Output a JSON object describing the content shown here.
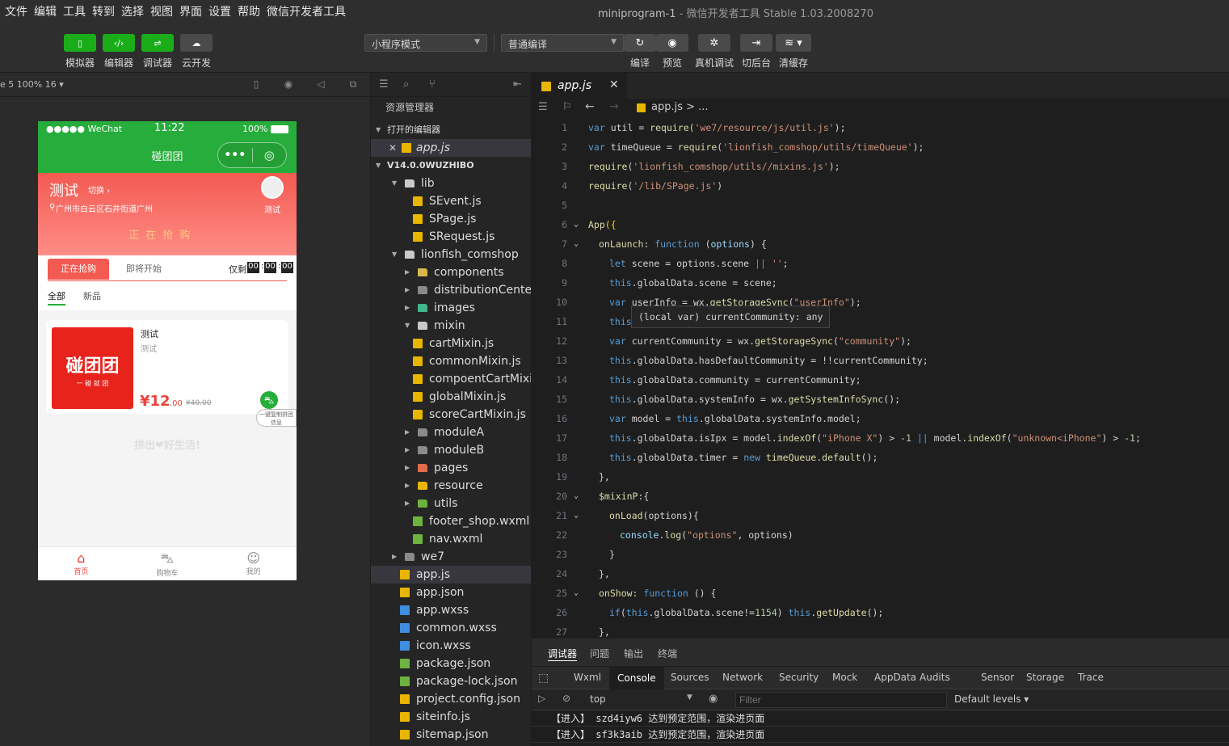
{
  "menu": {
    "items": [
      "文件",
      "编辑",
      "工具",
      "转到",
      "选择",
      "视图",
      "界面",
      "设置",
      "帮助",
      "微信开发者工具"
    ],
    "project": "miniprogram-1",
    "app_name": "微信开发者工具 Stable 1.03.2008270"
  },
  "toolbar": {
    "left": [
      {
        "label": "模拟器",
        "icon": "phone-icon"
      },
      {
        "label": "编辑器",
        "icon": "code-icon"
      },
      {
        "label": "调试器",
        "icon": "sliders-icon"
      },
      {
        "label": "云开发",
        "icon": "cloud-icon"
      }
    ],
    "mode_select": "小程序模式",
    "compile_select": "普通编译",
    "right": [
      {
        "label": "编译",
        "icon": "refresh-icon"
      },
      {
        "label": "预览",
        "icon": "eye-icon"
      },
      {
        "label": "真机调试",
        "icon": "bug-icon"
      },
      {
        "label": "切后台",
        "icon": "switch-icon"
      },
      {
        "label": "清缓存",
        "icon": "layers-icon"
      }
    ]
  },
  "simulator": {
    "device": "e 5 100% 16 ▾",
    "status": {
      "carrier": "●●●●● WeChat",
      "time": "11:22",
      "battery": "100%"
    },
    "nav_title": "碰团团",
    "banner": {
      "title": "测试",
      "switch": "切换 ›",
      "address": "广州市白云区石井街道广州",
      "avatar_label": "测试",
      "watermark": "正 在 抢 购"
    },
    "tabs": {
      "active": "正在抢购",
      "other": "即将开始",
      "countdown_label": "仅剩",
      "h": "00",
      "m": "00",
      "s": "00"
    },
    "subtabs": [
      "全部",
      "新品"
    ],
    "product": {
      "image_text": "碰团团",
      "image_sub": "一 碰 就 团",
      "title": "测试",
      "desc": "测试",
      "price": "¥12",
      "price_dec": ".00",
      "old_price": "¥40.00",
      "share_label": "一键复制拼团信息"
    },
    "slogan": "拼出❤好生活!",
    "tabbar": [
      "首页",
      "购物车",
      "我的"
    ]
  },
  "explorer": {
    "title": "资源管理器",
    "open_editors_label": "打开的编辑器",
    "open_file": "app.js",
    "project_label": "V14.0.0WUZHIBO",
    "tree": [
      {
        "name": "lib",
        "depth": 1,
        "type": "folder-open",
        "arrow": "open"
      },
      {
        "name": "SEvent.js",
        "depth": 2,
        "type": "js"
      },
      {
        "name": "SPage.js",
        "depth": 2,
        "type": "js"
      },
      {
        "name": "SRequest.js",
        "depth": 2,
        "type": "js"
      },
      {
        "name": "lionfish_comshop",
        "depth": 1,
        "type": "folder-open",
        "arrow": "open"
      },
      {
        "name": "components",
        "depth": 2,
        "type": "folder-comp",
        "arrow": "closed"
      },
      {
        "name": "distributionCenter",
        "depth": 2,
        "type": "folder",
        "arrow": "closed"
      },
      {
        "name": "images",
        "depth": 2,
        "type": "folder-img",
        "arrow": "closed"
      },
      {
        "name": "mixin",
        "depth": 2,
        "type": "folder-open",
        "arrow": "open"
      },
      {
        "name": "cartMixin.js",
        "depth": 3,
        "type": "js"
      },
      {
        "name": "commonMixin.js",
        "depth": 3,
        "type": "js"
      },
      {
        "name": "compoentCartMixi...",
        "depth": 3,
        "type": "js"
      },
      {
        "name": "globalMixin.js",
        "depth": 3,
        "type": "js"
      },
      {
        "name": "scoreCartMixin.js",
        "depth": 3,
        "type": "js"
      },
      {
        "name": "moduleA",
        "depth": 2,
        "type": "folder",
        "arrow": "closed"
      },
      {
        "name": "moduleB",
        "depth": 2,
        "type": "folder",
        "arrow": "closed"
      },
      {
        "name": "pages",
        "depth": 2,
        "type": "folder-pages",
        "arrow": "closed"
      },
      {
        "name": "resource",
        "depth": 2,
        "type": "folder-yellow",
        "arrow": "closed"
      },
      {
        "name": "utils",
        "depth": 2,
        "type": "folder-utils",
        "arrow": "closed"
      },
      {
        "name": "footer_shop.wxml",
        "depth": 2,
        "type": "wxml"
      },
      {
        "name": "nav.wxml",
        "depth": 2,
        "type": "wxml"
      },
      {
        "name": "we7",
        "depth": 1,
        "type": "folder",
        "arrow": "closed"
      },
      {
        "name": "app.js",
        "depth": 1,
        "type": "js",
        "selected": true
      },
      {
        "name": "app.json",
        "depth": 1,
        "type": "json"
      },
      {
        "name": "app.wxss",
        "depth": 1,
        "type": "wxss"
      },
      {
        "name": "common.wxss",
        "depth": 1,
        "type": "wxss"
      },
      {
        "name": "icon.wxss",
        "depth": 1,
        "type": "wxss"
      },
      {
        "name": "package.json",
        "depth": 1,
        "type": "pkg"
      },
      {
        "name": "package-lock.json",
        "depth": 1,
        "type": "pkg"
      },
      {
        "name": "project.config.json",
        "depth": 1,
        "type": "json"
      },
      {
        "name": "siteinfo.js",
        "depth": 1,
        "type": "js"
      },
      {
        "name": "sitemap.json",
        "depth": 1,
        "type": "json"
      }
    ]
  },
  "editor": {
    "tab": "app.js",
    "breadcrumb": "app.js > ...",
    "tooltip": "(local var) currentCommunity: any",
    "lines": [
      {
        "n": "1",
        "indent": 0,
        "fold": "",
        "tokens": [
          [
            "kw",
            "var "
          ],
          [
            "op",
            "util = "
          ],
          [
            "fn",
            "require"
          ],
          [
            "op",
            "("
          ],
          [
            "str",
            "'we7/resource/js/util.js'"
          ],
          [
            "op",
            ");"
          ]
        ]
      },
      {
        "n": "2",
        "indent": 0,
        "fold": "",
        "tokens": [
          [
            "kw",
            "var "
          ],
          [
            "op",
            "timeQueue = "
          ],
          [
            "fn",
            "require"
          ],
          [
            "op",
            "("
          ],
          [
            "str",
            "'lionfish_comshop/utils/timeQueue'"
          ],
          [
            "op",
            ");"
          ]
        ]
      },
      {
        "n": "3",
        "indent": 0,
        "fold": "",
        "tokens": [
          [
            "fn",
            "require"
          ],
          [
            "op",
            "("
          ],
          [
            "str",
            "'lionfish_comshop/utils//mixins.js'"
          ],
          [
            "op",
            ");"
          ]
        ]
      },
      {
        "n": "4",
        "indent": 0,
        "fold": "",
        "tokens": [
          [
            "fn",
            "require"
          ],
          [
            "op",
            "("
          ],
          [
            "str",
            "'/lib/SPage.js'"
          ],
          [
            "op",
            ")"
          ]
        ]
      },
      {
        "n": "5",
        "indent": 0,
        "fold": "",
        "tokens": []
      },
      {
        "n": "6",
        "indent": 0,
        "fold": "⌄",
        "tokens": [
          [
            "fn",
            "App"
          ],
          [
            "yel",
            "({"
          ]
        ]
      },
      {
        "n": "7",
        "indent": 1,
        "fold": "⌄",
        "tokens": [
          [
            "fn",
            "onLaunch"
          ],
          [
            "op",
            ": "
          ],
          [
            "kw",
            "function "
          ],
          [
            "op",
            "("
          ],
          [
            "var",
            "options"
          ],
          [
            "op",
            ") {"
          ]
        ]
      },
      {
        "n": "8",
        "indent": 2,
        "fold": "",
        "tokens": [
          [
            "kw",
            "let "
          ],
          [
            "op",
            "scene = options.scene "
          ],
          [
            "kw",
            "|| "
          ],
          [
            "str",
            "''"
          ],
          [
            "op",
            ";"
          ]
        ]
      },
      {
        "n": "9",
        "indent": 2,
        "fold": "",
        "tokens": [
          [
            "kw",
            "this"
          ],
          [
            "op",
            ".globalData.scene = scene;"
          ]
        ]
      },
      {
        "n": "10",
        "indent": 2,
        "fold": "",
        "tokens": [
          [
            "kw",
            "var "
          ],
          [
            "op",
            "userInfo = wx."
          ],
          [
            "fn",
            "getStorageSync"
          ],
          [
            "op",
            "("
          ],
          [
            "str",
            "\"userInfo\""
          ],
          [
            "op",
            ");"
          ]
        ]
      },
      {
        "n": "11",
        "indent": 2,
        "fold": "",
        "tokens": [
          [
            "kw",
            "this"
          ]
        ]
      },
      {
        "n": "12",
        "indent": 2,
        "fold": "",
        "tokens": [
          [
            "kw",
            "var "
          ],
          [
            "op",
            "currentCommunity = wx."
          ],
          [
            "fn",
            "getStorageSync"
          ],
          [
            "op",
            "("
          ],
          [
            "str",
            "\"community\""
          ],
          [
            "op",
            ");"
          ]
        ]
      },
      {
        "n": "13",
        "indent": 2,
        "fold": "",
        "tokens": [
          [
            "kw",
            "this"
          ],
          [
            "op",
            ".globalData.hasDefaultCommunity = !!currentCommunity;"
          ]
        ]
      },
      {
        "n": "14",
        "indent": 2,
        "fold": "",
        "tokens": [
          [
            "kw",
            "this"
          ],
          [
            "op",
            ".globalData.community = currentCommunity;"
          ]
        ]
      },
      {
        "n": "15",
        "indent": 2,
        "fold": "",
        "tokens": [
          [
            "kw",
            "this"
          ],
          [
            "op",
            ".globalData.systemInfo = wx."
          ],
          [
            "fn",
            "getSystemInfoSync"
          ],
          [
            "op",
            "();"
          ]
        ]
      },
      {
        "n": "16",
        "indent": 2,
        "fold": "",
        "tokens": [
          [
            "kw",
            "var "
          ],
          [
            "op",
            "model = "
          ],
          [
            "kw",
            "this"
          ],
          [
            "op",
            ".globalData.systemInfo.model;"
          ]
        ]
      },
      {
        "n": "17",
        "indent": 2,
        "fold": "",
        "tokens": [
          [
            "kw",
            "this"
          ],
          [
            "op",
            ".globalData.isIpx = model."
          ],
          [
            "fn",
            "indexOf"
          ],
          [
            "op",
            "("
          ],
          [
            "str",
            "\"iPhone X\""
          ],
          [
            "op",
            ") > "
          ],
          [
            "num2",
            "-1 "
          ],
          [
            "kw",
            "|| "
          ],
          [
            "op",
            "model."
          ],
          [
            "fn",
            "indexOf"
          ],
          [
            "op",
            "("
          ],
          [
            "str",
            "\"unknown<iPhone\""
          ],
          [
            "op",
            ") > "
          ],
          [
            "num2",
            "-1"
          ],
          [
            "op",
            ";"
          ]
        ]
      },
      {
        "n": "18",
        "indent": 2,
        "fold": "",
        "tokens": [
          [
            "kw",
            "this"
          ],
          [
            "op",
            ".globalData.timer = "
          ],
          [
            "kw",
            "new "
          ],
          [
            "fn",
            "timeQueue"
          ],
          [
            "op",
            "."
          ],
          [
            "fn",
            "default"
          ],
          [
            "op",
            "();"
          ]
        ]
      },
      {
        "n": "19",
        "indent": 1,
        "fold": "",
        "tokens": [
          [
            "op",
            "},"
          ]
        ]
      },
      {
        "n": "20",
        "indent": 1,
        "fold": "⌄",
        "tokens": [
          [
            "fn",
            "$mixinP"
          ],
          [
            "op",
            ":{"
          ]
        ]
      },
      {
        "n": "21",
        "indent": 2,
        "fold": "⌄",
        "tokens": [
          [
            "fn",
            "onLoad"
          ],
          [
            "op",
            "(options){"
          ]
        ]
      },
      {
        "n": "22",
        "indent": 3,
        "fold": "",
        "tokens": [
          [
            "var",
            "console"
          ],
          [
            "op",
            "."
          ],
          [
            "fn",
            "log"
          ],
          [
            "op",
            "("
          ],
          [
            "str",
            "\"options\""
          ],
          [
            "op",
            ", options)"
          ]
        ]
      },
      {
        "n": "23",
        "indent": 2,
        "fold": "",
        "tokens": [
          [
            "op",
            "}"
          ]
        ]
      },
      {
        "n": "24",
        "indent": 1,
        "fold": "",
        "tokens": [
          [
            "op",
            "},"
          ]
        ]
      },
      {
        "n": "25",
        "indent": 1,
        "fold": "⌄",
        "tokens": [
          [
            "fn",
            "onShow"
          ],
          [
            "op",
            ": "
          ],
          [
            "kw",
            "function "
          ],
          [
            "op",
            "() {"
          ]
        ]
      },
      {
        "n": "26",
        "indent": 2,
        "fold": "",
        "tokens": [
          [
            "kw",
            "if"
          ],
          [
            "op",
            "("
          ],
          [
            "kw",
            "this"
          ],
          [
            "op",
            ".globalData.scene!="
          ],
          [
            "num2",
            "1154"
          ],
          [
            "op",
            ") "
          ],
          [
            "kw",
            "this"
          ],
          [
            "op",
            "."
          ],
          [
            "fn",
            "getUpdate"
          ],
          [
            "op",
            "();"
          ]
        ]
      },
      {
        "n": "27",
        "indent": 1,
        "fold": "",
        "tokens": [
          [
            "op",
            "},"
          ]
        ]
      }
    ]
  },
  "debugger": {
    "tabs": [
      "调试器",
      "问题",
      "输出",
      "终端"
    ],
    "console_tabs": [
      "Wxml",
      "Console",
      "Sources",
      "Network",
      "Security",
      "Mock",
      "AppData",
      "Audits",
      "Sensor",
      "Storage",
      "Trace"
    ],
    "active_console_tab": "Console",
    "context": "top",
    "filter_placeholder": "Filter",
    "levels": "Default levels ▾",
    "logs": [
      "【进入】 szd4iyw6 达到预定范围，渲染进页面",
      "【进入】 sf3k3aib 达到预定范围，渲染进页面"
    ]
  },
  "colors": {
    "brand_green": "#1aad19",
    "nav_green": "#26ad3b",
    "price_red": "#e8443c",
    "banner_red": "#f25a52"
  }
}
